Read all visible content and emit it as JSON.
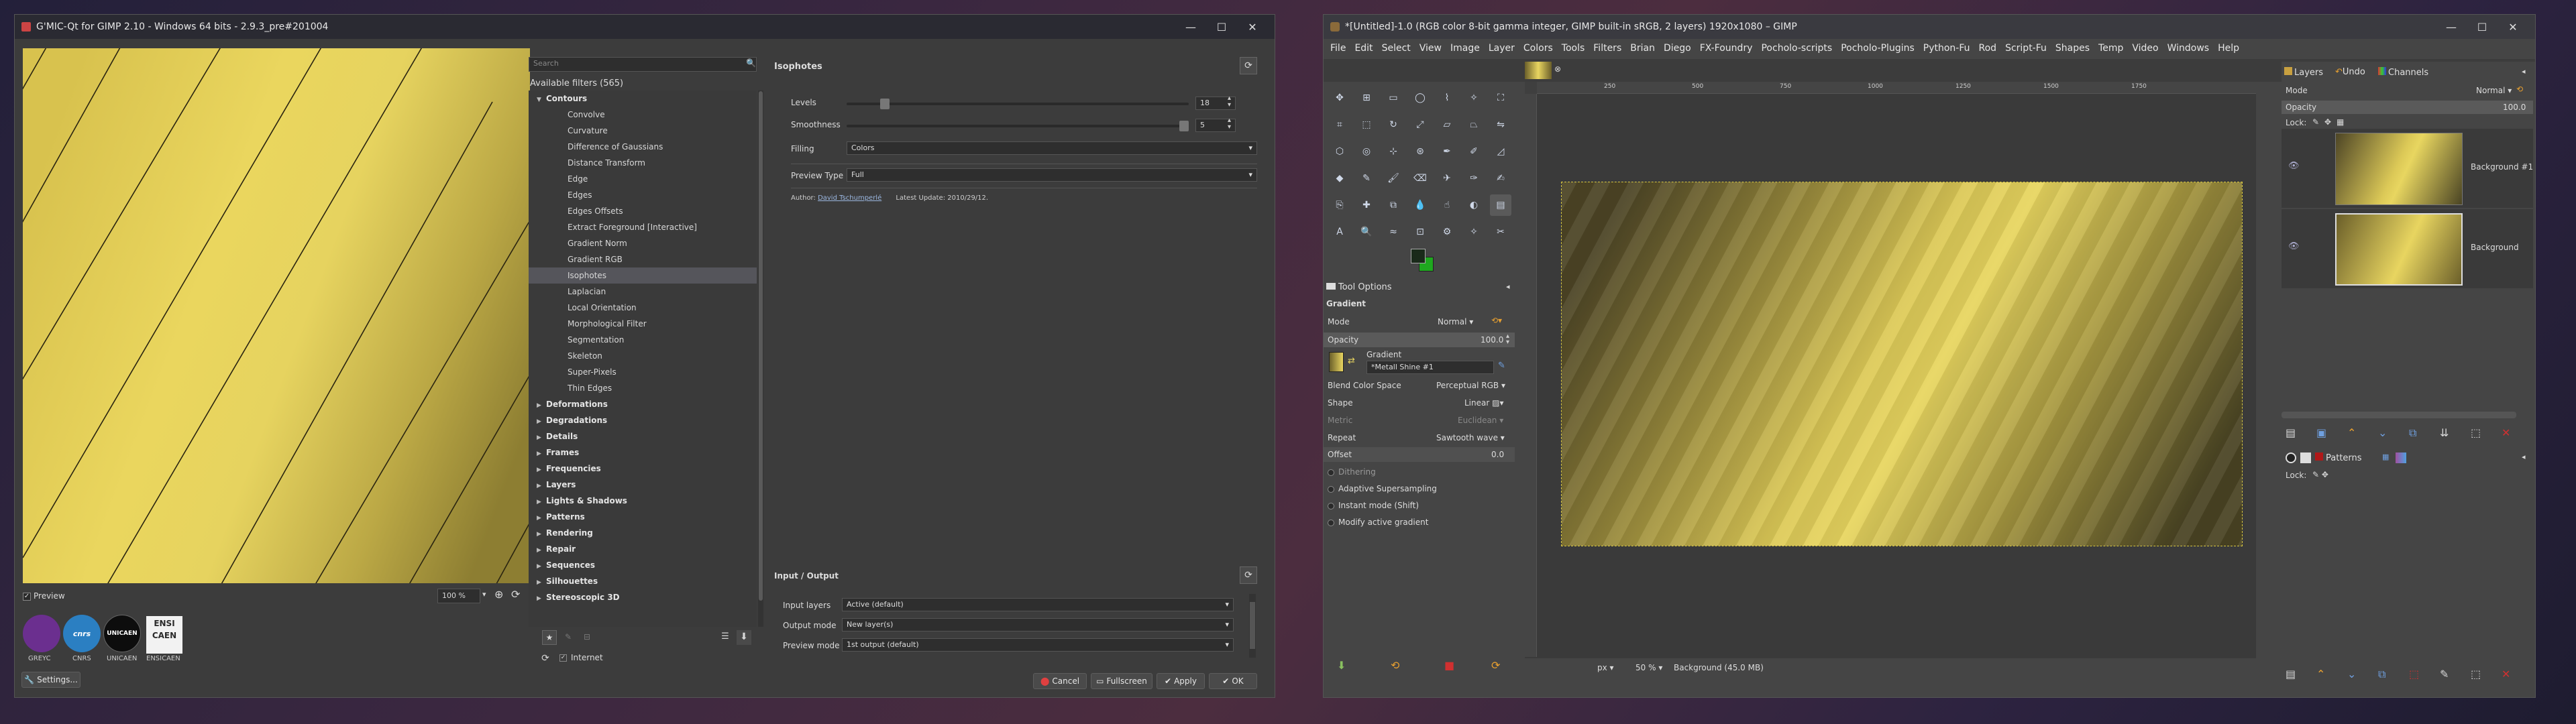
{
  "gmic": {
    "title": "G'MIC-Qt for GIMP 2.10 - Windows 64 bits - 2.9.3_pre#201004",
    "win_controls": [
      "—",
      "☐",
      "✕"
    ],
    "preview_label": "Preview",
    "zoom": "100 %",
    "logos": [
      "GREYC",
      "CNRS",
      "UNICAEN",
      "ENSICAEN"
    ],
    "settings_label": "Settings...",
    "search_placeholder": "Search",
    "filters_header": "Available filters (565)",
    "contours_label": "Contours",
    "contours_items": [
      "Convolve",
      "Curvature",
      "Difference of Gaussians",
      "Distance Transform",
      "Edge",
      "Edges",
      "Edges Offsets",
      "Extract Foreground [Interactive]",
      "Gradient Norm",
      "Gradient RGB",
      "Isophotes",
      "Laplacian",
      "Local Orientation",
      "Morphological Filter",
      "Segmentation",
      "Skeleton",
      "Super-Pixels",
      "Thin Edges"
    ],
    "categories": [
      "Deformations",
      "Degradations",
      "Details",
      "Frames",
      "Frequencies",
      "Layers",
      "Lights & Shadows",
      "Patterns",
      "Rendering",
      "Repair",
      "Sequences",
      "Silhouettes",
      "Stereoscopic 3D"
    ],
    "internet_label": "Internet",
    "filter_title": "Isophotes",
    "params": {
      "levels_label": "Levels",
      "levels_value": "18",
      "levels_fraction": 0.1,
      "smoothness_label": "Smoothness",
      "smoothness_value": "5",
      "smoothness_fraction": 1.0,
      "filling_label": "Filling",
      "filling_value": "Colors",
      "preview_type_label": "Preview Type",
      "preview_type_value": "Full",
      "author_prefix": "Author:",
      "author_name": "David Tschumperlé",
      "updated": "Latest Update: 2010/29/12."
    },
    "io": {
      "header": "Input / Output",
      "input_label": "Input layers",
      "input_value": "Active (default)",
      "output_label": "Output mode",
      "output_value": "New layer(s)",
      "preview_label": "Preview mode",
      "preview_value": "1st output (default)"
    },
    "buttons": {
      "cancel": "Cancel",
      "fullscreen": "Fullscreen",
      "apply": "Apply",
      "ok": "OK"
    }
  },
  "gimp": {
    "title": "*[Untitled]-1.0 (RGB color 8-bit gamma integer, GIMP built-in sRGB, 2 layers) 1920x1080 – GIMP",
    "win_controls": [
      "—",
      "☐",
      "✕"
    ],
    "menu": [
      "File",
      "Edit",
      "Select",
      "View",
      "Image",
      "Layer",
      "Colors",
      "Tools",
      "Filters",
      "Brian",
      "Diego",
      "FX-Foundry",
      "Pocholo-scripts",
      "Pocholo-Plugins",
      "Python-Fu",
      "Rod",
      "Script-Fu",
      "Shapes",
      "Temp",
      "Video",
      "Windows",
      "Help"
    ],
    "ruler_ticks": [
      "250",
      "500",
      "750",
      "1000",
      "1250",
      "1500",
      "1750"
    ],
    "tool_options": {
      "tab": "Tool Options",
      "title": "Gradient",
      "mode_label": "Mode",
      "mode_value": "Normal",
      "opacity_label": "Opacity",
      "opacity_value": "100.0",
      "gradient_label": "Gradient",
      "gradient_name": "*Metall Shine #1",
      "blend_label": "Blend Color Space",
      "blend_value": "Perceptual RGB",
      "shape_label": "Shape",
      "shape_value": "Linear",
      "metric_label": "Metric",
      "metric_value": "Euclidean",
      "repeat_label": "Repeat",
      "repeat_value": "Sawtooth wave",
      "offset_label": "Offset",
      "offset_value": "0.0",
      "dithering": "Dithering",
      "adaptive": "Adaptive Supersampling",
      "instant": "Instant mode  (Shift)",
      "modify": "Modify active gradient"
    },
    "status": {
      "unit": "px",
      "zoom": "50 %",
      "info": "Background (45.0 MB)"
    },
    "layers": {
      "tabs": [
        "Layers",
        "Undo",
        "Channels"
      ],
      "mode_label": "Mode",
      "mode_value": "Normal",
      "opacity_label": "Opacity",
      "opacity_value": "100.0",
      "lock_label": "Lock:",
      "items": [
        "Background #1",
        "Background"
      ]
    },
    "patterns": {
      "tab": "Patterns",
      "lock_label": "Lock:"
    }
  }
}
